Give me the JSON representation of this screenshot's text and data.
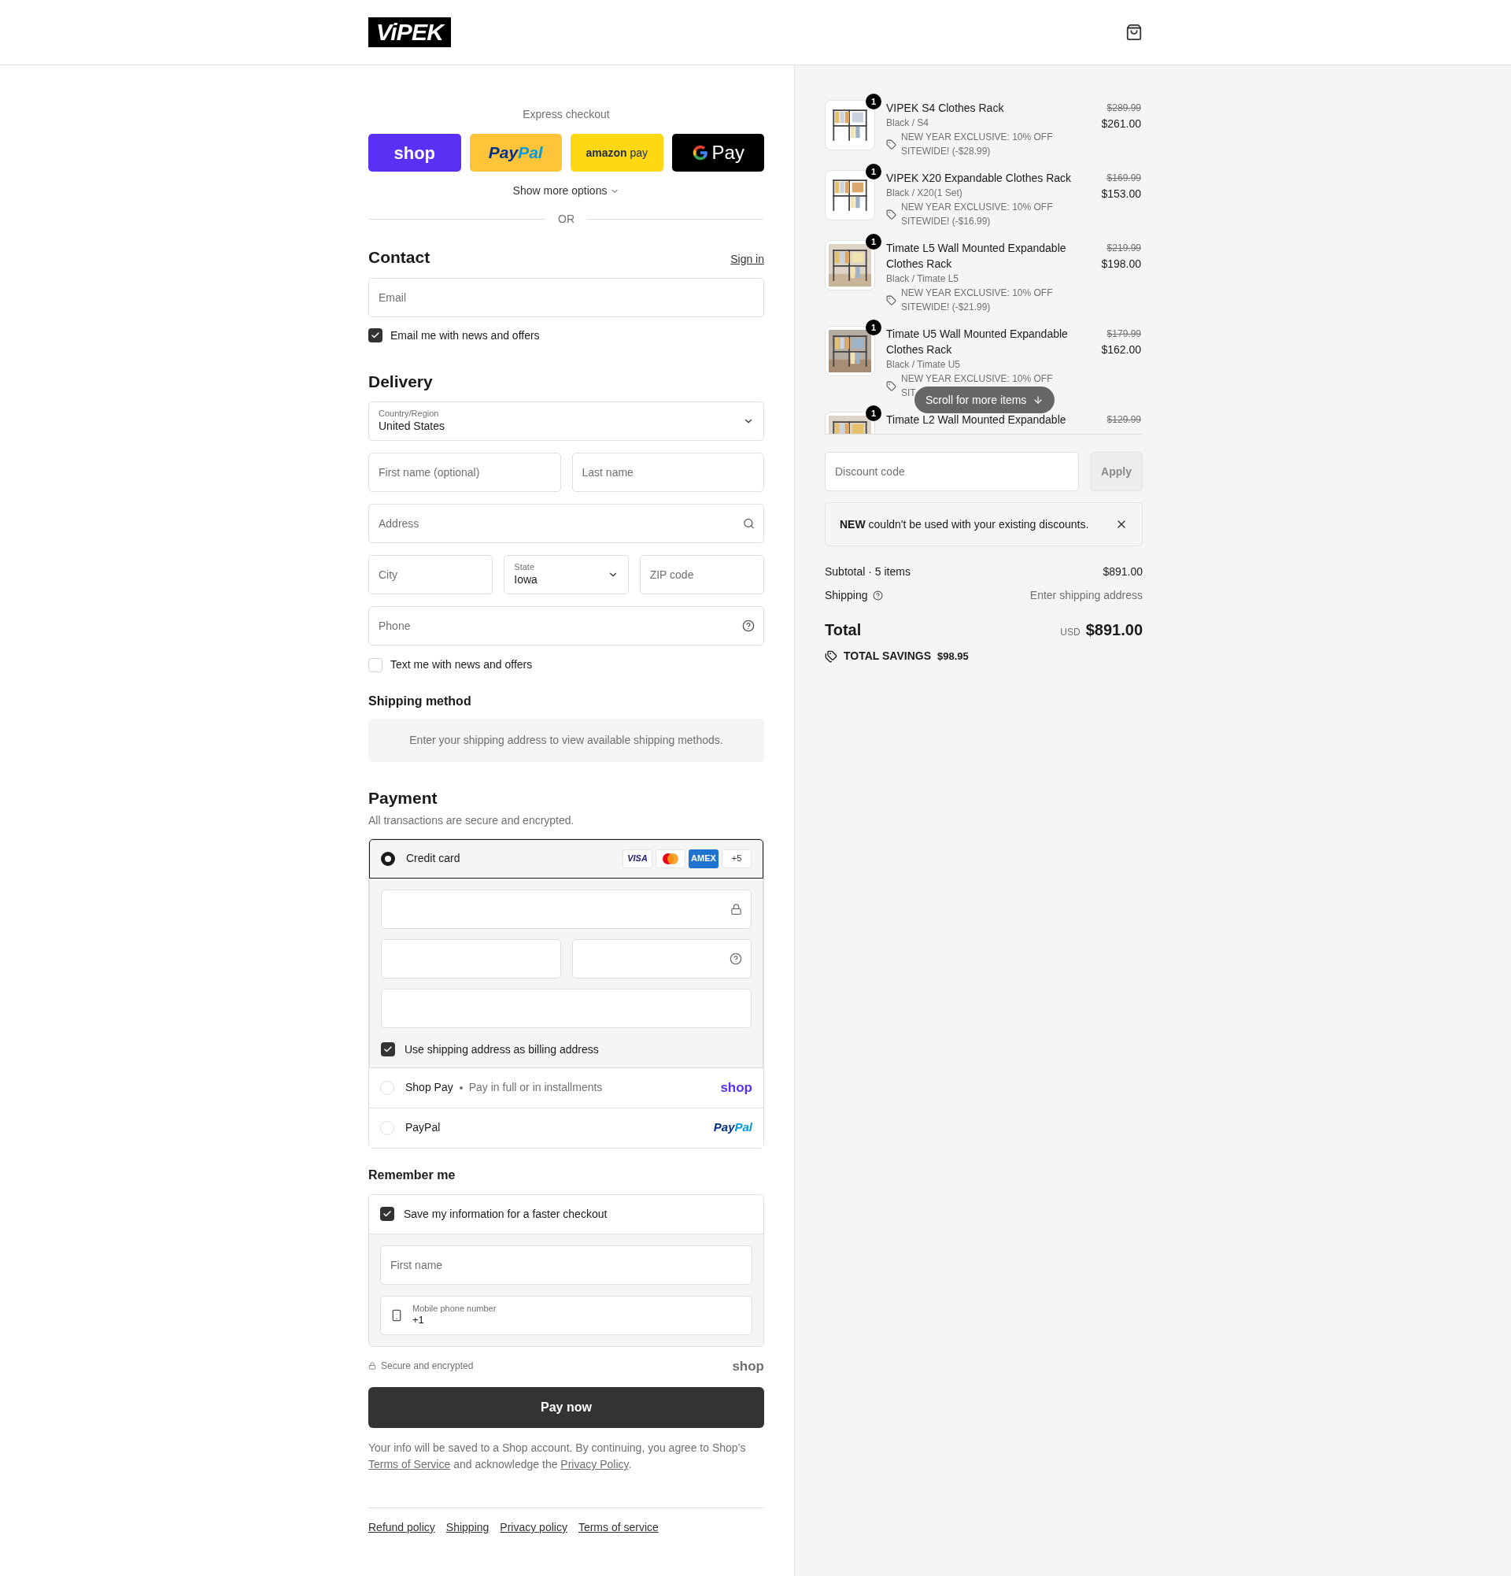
{
  "header": {
    "logo": "ViPEK"
  },
  "express": {
    "label": "Express checkout",
    "buttons": [
      {
        "kind": "shop",
        "parts": [
          "shop"
        ]
      },
      {
        "kind": "paypal",
        "parts": [
          "Pay",
          "Pal"
        ]
      },
      {
        "kind": "amazon",
        "parts": [
          "amazon",
          "pay"
        ]
      },
      {
        "kind": "gpay",
        "parts": [
          "Pay"
        ]
      }
    ],
    "show_more": "Show more options",
    "or": "OR"
  },
  "contact": {
    "title": "Contact",
    "sign_in": "Sign in",
    "email_placeholder": "Email",
    "news": {
      "label": "Email me with news and offers",
      "checked": true
    }
  },
  "delivery": {
    "title": "Delivery",
    "country": {
      "label": "Country/Region",
      "value": "United States"
    },
    "first_name": {
      "placeholder": "First name (optional)"
    },
    "last_name": {
      "placeholder": "Last name"
    },
    "address": {
      "placeholder": "Address"
    },
    "city": {
      "placeholder": "City"
    },
    "state": {
      "label": "State",
      "value": "Iowa"
    },
    "zip": {
      "placeholder": "ZIP code"
    },
    "phone": {
      "placeholder": "Phone"
    },
    "sms": {
      "label": "Text me with news and offers",
      "checked": false
    }
  },
  "shipping_method": {
    "title": "Shipping method",
    "note": "Enter your shipping address to view available shipping methods."
  },
  "payment": {
    "title": "Payment",
    "subtitle": "All transactions are secure and encrypted.",
    "methods": [
      {
        "kind": "card",
        "label": "Credit card",
        "selected": true,
        "brands": [
          {
            "kind": "visa",
            "label": "VISA"
          },
          {
            "kind": "mastercard"
          },
          {
            "kind": "amex",
            "label": "AMEX"
          },
          {
            "kind": "more",
            "label": "+5"
          }
        ],
        "billing": {
          "label": "Use shipping address as billing address",
          "checked": true
        }
      },
      {
        "kind": "shoppay",
        "label": "Shop Pay",
        "note": "Pay in full or in installments",
        "logo": [
          "shop"
        ],
        "selected": false
      },
      {
        "kind": "paypal",
        "label": "PayPal",
        "logo": [
          "Pay",
          "Pal"
        ],
        "selected": false
      }
    ]
  },
  "remember": {
    "title": "Remember me",
    "save": {
      "label": "Save my information for a faster checkout",
      "checked": true
    },
    "first_name": {
      "placeholder": "First name"
    },
    "mobile": {
      "label": "Mobile phone number",
      "value": "+1"
    },
    "secure": "Secure and encrypted",
    "shop_logo": "shop"
  },
  "pay_button": "Pay now",
  "legal": {
    "text": "Your info will be saved to a Shop account. By continuing, you agree to Shop’s",
    "terms": "Terms of Service",
    "middle": "and acknowledge the",
    "privacy": "Privacy Policy",
    "end": "."
  },
  "footer_links": [
    "Refund policy",
    "Shipping",
    "Privacy policy",
    "Terms of service"
  ],
  "summary": {
    "items": [
      {
        "quantity": "1",
        "title": "VIPEK S4 Clothes Rack",
        "variant": "Black / S4",
        "discount": [
          "NEW YEAR EXCLUSIVE: 10% OFF",
          "SITEWIDE! (-$28.99)"
        ],
        "original_price": "$289.99",
        "price": "$261.00"
      },
      {
        "quantity": "1",
        "title": "VIPEK X20 Expandable Clothes Rack",
        "variant": "Black / X20(1 Set)",
        "discount": [
          "NEW YEAR EXCLUSIVE: 10% OFF",
          "SITEWIDE! (-$16.99)"
        ],
        "original_price": "$169.99",
        "price": "$153.00"
      },
      {
        "quantity": "1",
        "title": "Timate L5 Wall Mounted Expandable Clothes Rack",
        "variant": "Black / Timate L5",
        "discount": [
          "NEW YEAR EXCLUSIVE: 10% OFF",
          "SITEWIDE! (-$21.99)"
        ],
        "original_price": "$219.99",
        "price": "$198.00"
      },
      {
        "quantity": "1",
        "title": "Timate U5 Wall Mounted Expandable Clothes Rack",
        "variant": "Black / Timate U5",
        "discount": [
          "NEW YEAR EXCLUSIVE: 10% OFF",
          "SIT"
        ],
        "original_price": "$179.99",
        "price": "$162.00"
      },
      {
        "quantity": "1",
        "title": "Timate L2 Wall Mounted Expandable",
        "original_price": "$129.99"
      }
    ],
    "scroll_hint": "Scroll for more items",
    "discount": {
      "placeholder": "Discount code",
      "apply": "Apply",
      "disabled": true
    },
    "notice": "**NEW** couldn't be used with your existing discounts.",
    "subtotal": {
      "label": "Subtotal · 5 items",
      "value": "$891.00"
    },
    "shipping": {
      "label": "Shipping",
      "value": "Enter shipping address"
    },
    "total": {
      "label": "Total",
      "currency": "USD",
      "value": "$891.00"
    },
    "savings": {
      "label": "TOTAL SAVINGS",
      "value": "$98.95"
    }
  }
}
